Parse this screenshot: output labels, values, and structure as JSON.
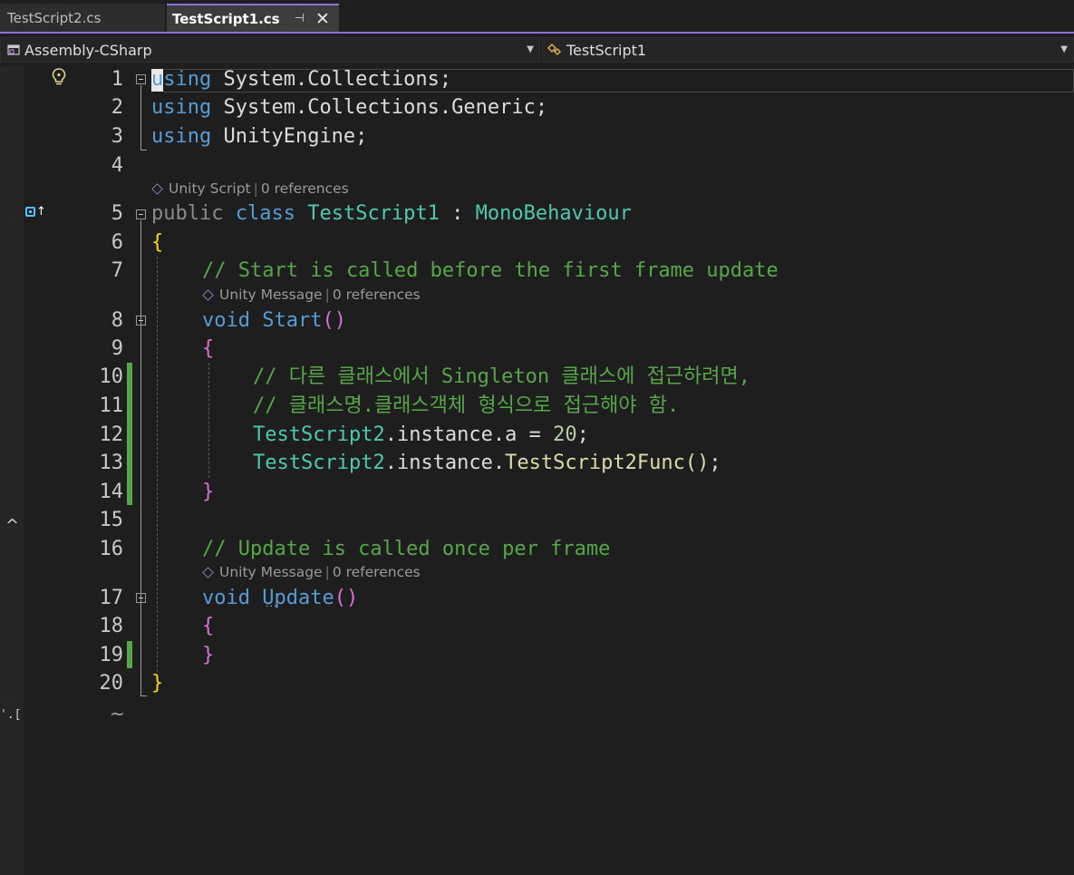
{
  "tabs": [
    {
      "label": "TestScript2.cs",
      "active": false
    },
    {
      "label": "TestScript1.cs",
      "active": true
    }
  ],
  "navbar": {
    "project": "Assembly-CSharp",
    "type": "TestScript1"
  },
  "left_fragment": "'.[",
  "lens": {
    "class": {
      "kind": "Unity Script",
      "refs": "0 references"
    },
    "start": {
      "kind": "Unity Message",
      "refs": "0 references"
    },
    "update": {
      "kind": "Unity Message",
      "refs": "0 references"
    }
  },
  "line_numbers": [
    "1",
    "2",
    "3",
    "4",
    "5",
    "6",
    "7",
    "8",
    "9",
    "10",
    "11",
    "12",
    "13",
    "14",
    "15",
    "16",
    "17",
    "18",
    "19",
    "20"
  ],
  "code": {
    "l1": {
      "kw": "using",
      "rest": " System.Collections;"
    },
    "l2": {
      "kw": "using",
      "rest": " System.Collections.Generic;"
    },
    "l3": {
      "kw": "using",
      "rest": " UnityEngine;"
    },
    "l5": {
      "public": "public",
      "class": "class",
      "name": "TestScript1",
      "colon": " : ",
      "base": "MonoBehaviour"
    },
    "l6": "{",
    "l7": "// Start is called before the first frame update",
    "l8": {
      "kw": "void",
      "name": "Start",
      "parens": "()"
    },
    "l9": "{",
    "l10": "// 다른 클래스에서 Singleton 클래스에 접근하려면,",
    "l11": "// 클래스명.클래스객체 형식으로 접근해야 함.",
    "l12": {
      "cls": "TestScript2",
      "mid": ".instance.a = ",
      "num": "20",
      "end": ";"
    },
    "l13": {
      "cls": "TestScript2",
      "mid": ".instance.",
      "mth": "TestScript2Func",
      "parens": "()",
      "end": ";"
    },
    "l14": "}",
    "l16": "// Update is called once per frame",
    "l17": {
      "kw": "void",
      "name": "Update",
      "parens": "()"
    },
    "l18": "{",
    "l19": "}",
    "l20": "}"
  },
  "colors": {
    "keyword": "#569cd6",
    "type": "#4ec9b0",
    "comment": "#57a64a",
    "number": "#b5cea8",
    "method": "#dcdcaa",
    "accent": "#8f6fd9",
    "change_bar": "#57a64a"
  },
  "icons": [
    "lightbulb-icon",
    "pin-icon",
    "close-icon",
    "project-icon",
    "class-icon",
    "dropdown-arrow-icon",
    "codelens-cube-icon",
    "fold-icon"
  ]
}
